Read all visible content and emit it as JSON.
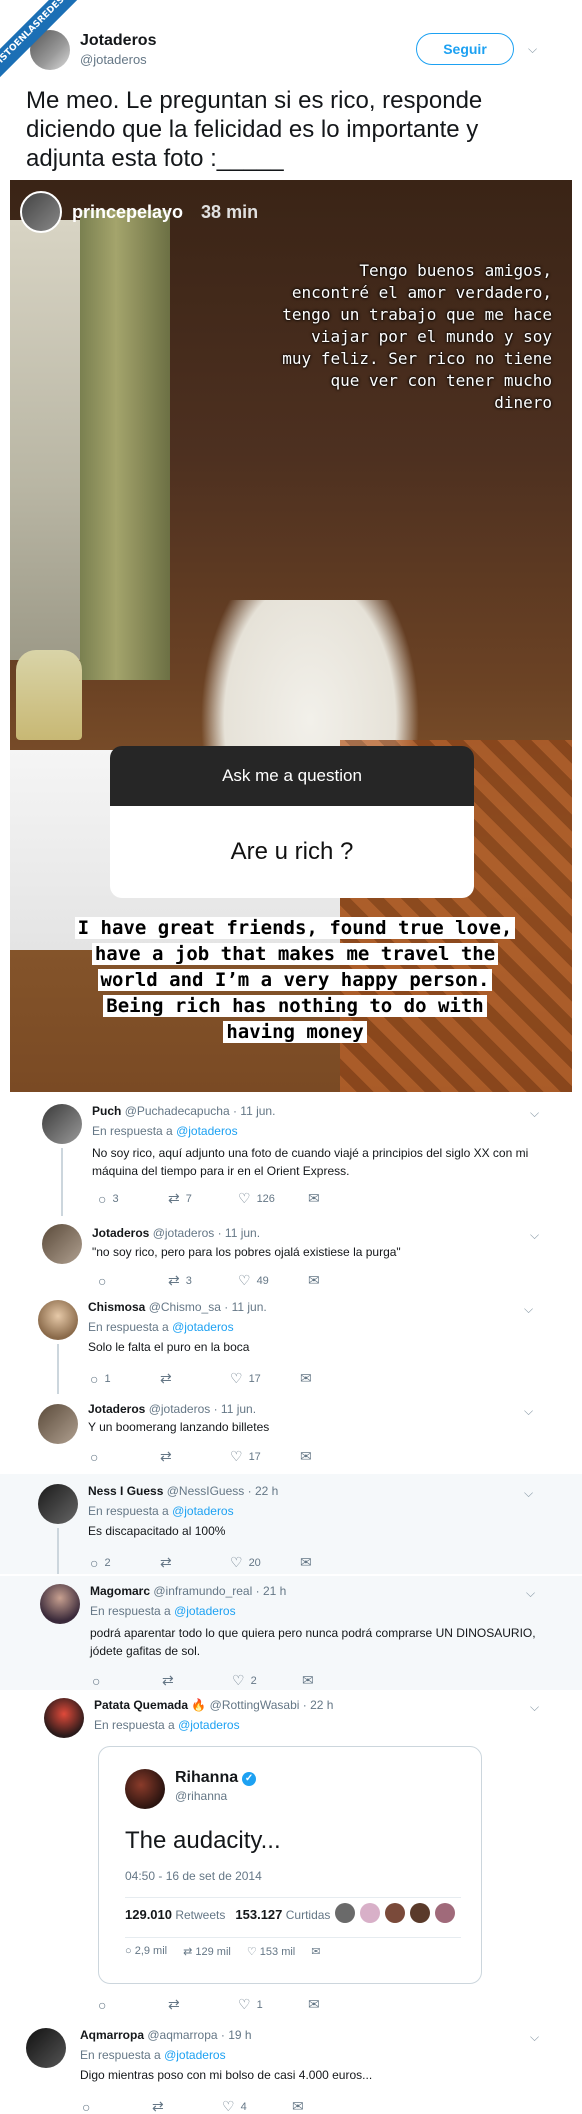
{
  "watermark": "VISTOENLASREDES.COM",
  "main_tweet": {
    "name": "Jotaderos",
    "handle": "@jotaderos",
    "follow_label": "Seguir",
    "text": "Me meo. Le preguntan si es rico, responde diciendo que la felicidad es lo importante y adjunta esta foto :_____"
  },
  "story": {
    "user": "princepelayo",
    "time": "38 min",
    "answer_es": "Tengo buenos amigos, encontré el amor verdadero, tengo un trabajo que me hace viajar por el mundo y soy muy feliz. Ser rico no tiene que ver con tener mucho dinero",
    "question_header": "Ask me a question",
    "question": "Are u rich ?",
    "answer_en": "I have great friends, found true love, have a job that makes me travel the world and  I’m a very happy person. Being rich has nothing to do with having money"
  },
  "in_reply_label": "En respuesta a",
  "in_reply_handle": "@jotaderos",
  "replies": [
    {
      "name": "Puch",
      "handle": "@Puchadecapucha",
      "time": "· 11 jun.",
      "text": "No soy rico, aquí adjunto una foto de cuando viajé a principios del siglo XX con mi máquina del tiempo para ir en el Orient Express.",
      "replies": "3",
      "retweets": "7",
      "likes": "126"
    },
    {
      "name": "Jotaderos",
      "handle": "@jotaderos",
      "time": "· 11 jun.",
      "text": "\"no soy rico, pero para los pobres ojalá existiese la purga\"",
      "replies": "",
      "retweets": "3",
      "likes": "49"
    },
    {
      "name": "Chismosa",
      "handle": "@Chismo_sa",
      "time": "· 11 jun.",
      "text": "Solo le falta el puro en la boca",
      "replies": "1",
      "retweets": "",
      "likes": "17"
    },
    {
      "name": "Jotaderos",
      "handle": "@jotaderos",
      "time": "· 11 jun.",
      "text": "Y un boomerang lanzando billetes",
      "replies": "",
      "retweets": "",
      "likes": "17"
    },
    {
      "name": "Ness I Guess",
      "handle": "@NessIGuess",
      "time": "· 22 h",
      "text": "Es discapacitado al 100%",
      "replies": "2",
      "retweets": "",
      "likes": "20"
    },
    {
      "name": "Magomarc",
      "handle": "@inframundo_real",
      "time": "· 21 h",
      "text": "podrá aparentar todo lo que quiera pero nunca podrá comprarse UN DINOSAURIO, jódete gafitas de sol.",
      "replies": "",
      "retweets": "",
      "likes": "2"
    },
    {
      "name": "Patata Quemada 🔥",
      "handle": "@RottingWasabi",
      "time": "· 22 h",
      "text": "",
      "replies": "",
      "retweets": "",
      "likes": "1"
    },
    {
      "name": "Aqmarropa",
      "handle": "@aqmarropa",
      "time": "· 19 h",
      "text": "Digo mientras poso con mi bolso de casi 4.000 euros...",
      "replies": "",
      "retweets": "",
      "likes": "4"
    }
  ],
  "quote": {
    "name": "Rihanna",
    "handle": "@rihanna",
    "text": "The audacity...",
    "date": "04:50 - 16 de set de 2014",
    "retweets_value": "129.010",
    "retweets_label": "Retweets",
    "likes_value": "153.127",
    "likes_label": "Curtidas",
    "replies": "2,9 mil",
    "rts": "129 mil",
    "favs": "153 mil"
  }
}
